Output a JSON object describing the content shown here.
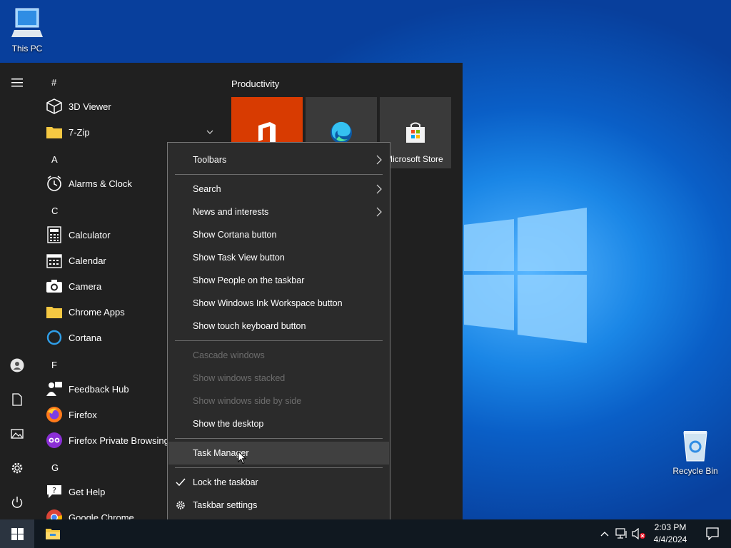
{
  "desktop": {
    "this_pc": "This PC",
    "recycle_bin": "Recycle Bin"
  },
  "start_menu": {
    "group_title": "Productivity",
    "tiles": [
      {
        "label": "",
        "icon": "office-icon",
        "color": "#d83b01"
      },
      {
        "label": "",
        "icon": "edge-icon",
        "color": "#3a3a3a"
      },
      {
        "label": "Microsoft Store",
        "icon": "store-icon",
        "color": "#3a3a3a"
      }
    ],
    "letters": [
      "#",
      "A",
      "C",
      "F",
      "G"
    ],
    "apps": [
      {
        "name": "3D Viewer",
        "icon": "3d-viewer-icon"
      },
      {
        "name": "7-Zip",
        "icon": "folder-icon"
      },
      {
        "name": "Alarms & Clock",
        "icon": "alarm-clock-icon"
      },
      {
        "name": "Calculator",
        "icon": "calculator-icon"
      },
      {
        "name": "Calendar",
        "icon": "calendar-icon"
      },
      {
        "name": "Camera",
        "icon": "camera-icon"
      },
      {
        "name": "Chrome Apps",
        "icon": "folder-icon"
      },
      {
        "name": "Cortana",
        "icon": "cortana-icon"
      },
      {
        "name": "Feedback Hub",
        "icon": "feedback-hub-icon"
      },
      {
        "name": "Firefox",
        "icon": "firefox-icon"
      },
      {
        "name": "Firefox Private Browsing",
        "icon": "firefox-private-icon"
      },
      {
        "name": "Get Help",
        "icon": "get-help-icon"
      },
      {
        "name": "Google Chrome",
        "icon": "chrome-icon"
      }
    ]
  },
  "context_menu": {
    "items": [
      {
        "label": "Toolbars",
        "submenu": true
      },
      {
        "label": "Search",
        "submenu": true
      },
      {
        "label": "News and interests",
        "submenu": true
      },
      {
        "label": "Show Cortana button"
      },
      {
        "label": "Show Task View button"
      },
      {
        "label": "Show People on the taskbar"
      },
      {
        "label": "Show Windows Ink Workspace button"
      },
      {
        "label": "Show touch keyboard button"
      },
      {
        "label": "Cascade windows",
        "disabled": true
      },
      {
        "label": "Show windows stacked",
        "disabled": true
      },
      {
        "label": "Show windows side by side",
        "disabled": true
      },
      {
        "label": "Show the desktop"
      },
      {
        "label": "Task Manager",
        "highlighted": true
      },
      {
        "label": "Lock the taskbar",
        "checked": true
      },
      {
        "label": "Taskbar settings",
        "icon": "gear-icon"
      }
    ]
  },
  "taskbar": {
    "time": "2:03 PM",
    "date": "4/4/2024"
  },
  "colors": {
    "accent": "#0078d7",
    "start_menu_bg": "#202020",
    "menu_bg": "#2b2b2b",
    "taskbar_bg": "#101820"
  }
}
